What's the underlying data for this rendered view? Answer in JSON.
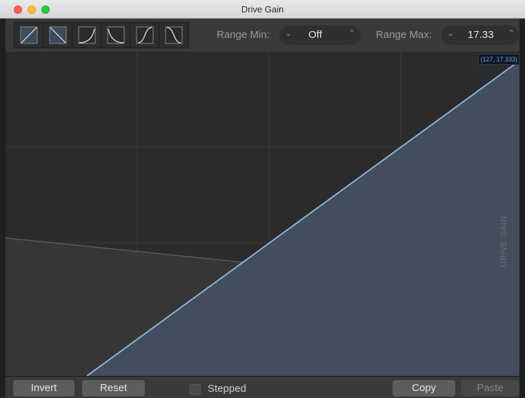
{
  "window": {
    "title": "Drive Gain"
  },
  "toolbar": {
    "curve_buttons": [
      "linear-rise-icon",
      "linear-fall-icon",
      "exponential-rise-icon",
      "exponential-fall-icon",
      "s-curve-rise-icon",
      "s-curve-fall-icon"
    ],
    "range_min": {
      "label": "Range Min:",
      "value": "Off"
    },
    "range_max": {
      "label": "Range Max:",
      "value": "17.33"
    }
  },
  "plot": {
    "coordinate_readout": "(127, 17.333)",
    "axis_label": "DRIVE GAIN",
    "line_color": "#8fb3dd",
    "fill_color": "#435061"
  },
  "bottom": {
    "invert_label": "Invert",
    "reset_label": "Reset",
    "stepped_label": "Stepped",
    "copy_label": "Copy",
    "paste_label": "Paste"
  }
}
